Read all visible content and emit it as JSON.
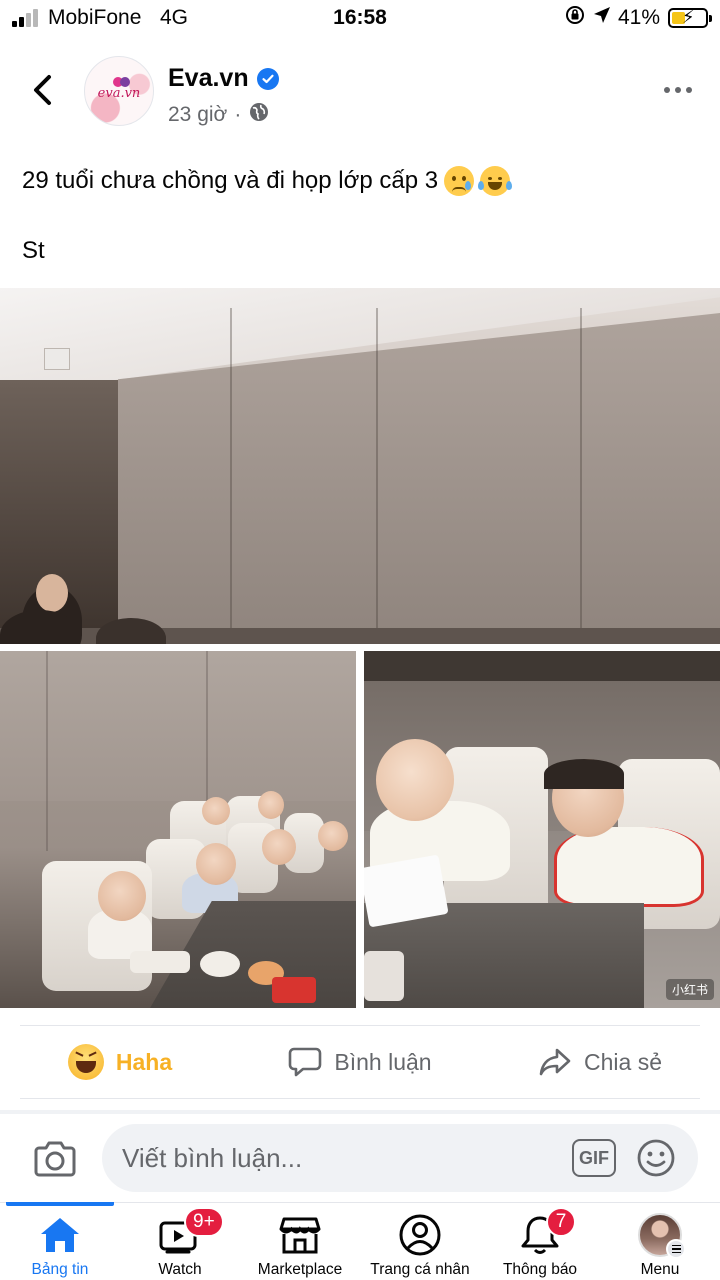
{
  "status_bar": {
    "carrier": "MobiFone",
    "network": "4G",
    "time": "16:58",
    "battery_percent": "41%",
    "battery_level": 0.41
  },
  "post": {
    "page_name": "Eva.vn",
    "avatar_text": "eva.vn",
    "timestamp": "23 giờ",
    "separator": "·",
    "caption": "29 tuổi chưa chồng và đi họp lớp cấp 3",
    "caption_emojis": [
      "crying-face",
      "tears-of-joy-face"
    ],
    "caption_line2": "St",
    "photo_watermark": "小红书"
  },
  "actions": {
    "reaction_label": "Haha",
    "comment_label": "Bình luận",
    "share_label": "Chia sẻ"
  },
  "comment_bar": {
    "placeholder": "Viết bình luận...",
    "gif_label": "GIF"
  },
  "tabs": [
    {
      "label": "Bảng tin",
      "icon": "home-icon",
      "active": true
    },
    {
      "label": "Watch",
      "icon": "watch-icon",
      "badge": "9+"
    },
    {
      "label": "Marketplace",
      "icon": "marketplace-icon"
    },
    {
      "label": "Trang cá nhân",
      "icon": "profile-icon"
    },
    {
      "label": "Thông báo",
      "icon": "bell-icon",
      "badge": "7"
    },
    {
      "label": "Menu",
      "icon": "menu-avatar-icon"
    }
  ],
  "colors": {
    "brand_blue": "#1877f2",
    "haha_yellow": "#f7b125",
    "badge_red": "#e41e3f",
    "secondary_text": "#65676b"
  }
}
